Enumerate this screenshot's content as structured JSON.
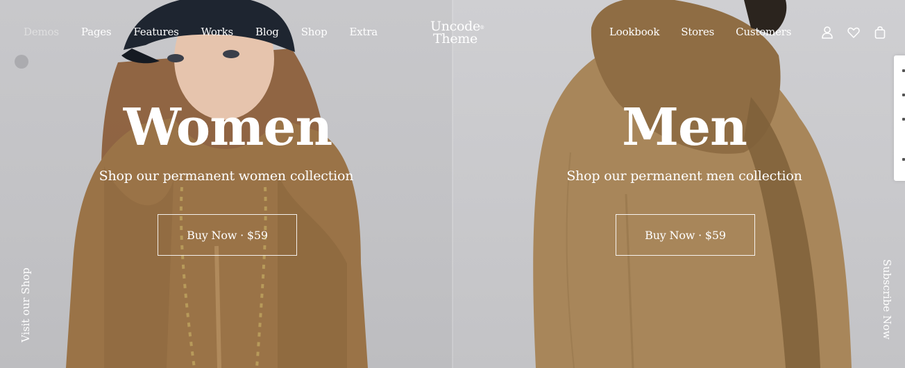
{
  "nav_left": [
    "Demos",
    "Pages",
    "Features",
    "Works",
    "Blog",
    "Shop",
    "Extra"
  ],
  "logo": {
    "line1": "Uncode",
    "line2": "Theme",
    "mark": "®"
  },
  "nav_right": [
    "Lookbook",
    "Stores",
    "Customers"
  ],
  "icons": [
    "user-icon",
    "heart-icon",
    "shopping-bag-icon"
  ],
  "women": {
    "title": "Women",
    "subtitle": "Shop our permanent women collection",
    "button": "Buy Now · $59"
  },
  "men": {
    "title": "Men",
    "subtitle": "Shop our permanent men collection",
    "button": "Buy Now · $59"
  },
  "side_left": "Visit our Shop",
  "side_right": "Subscribe Now",
  "colors": {
    "text": "#ffffff",
    "hoodie": "#9a7347",
    "background": "#c9c9cc"
  }
}
